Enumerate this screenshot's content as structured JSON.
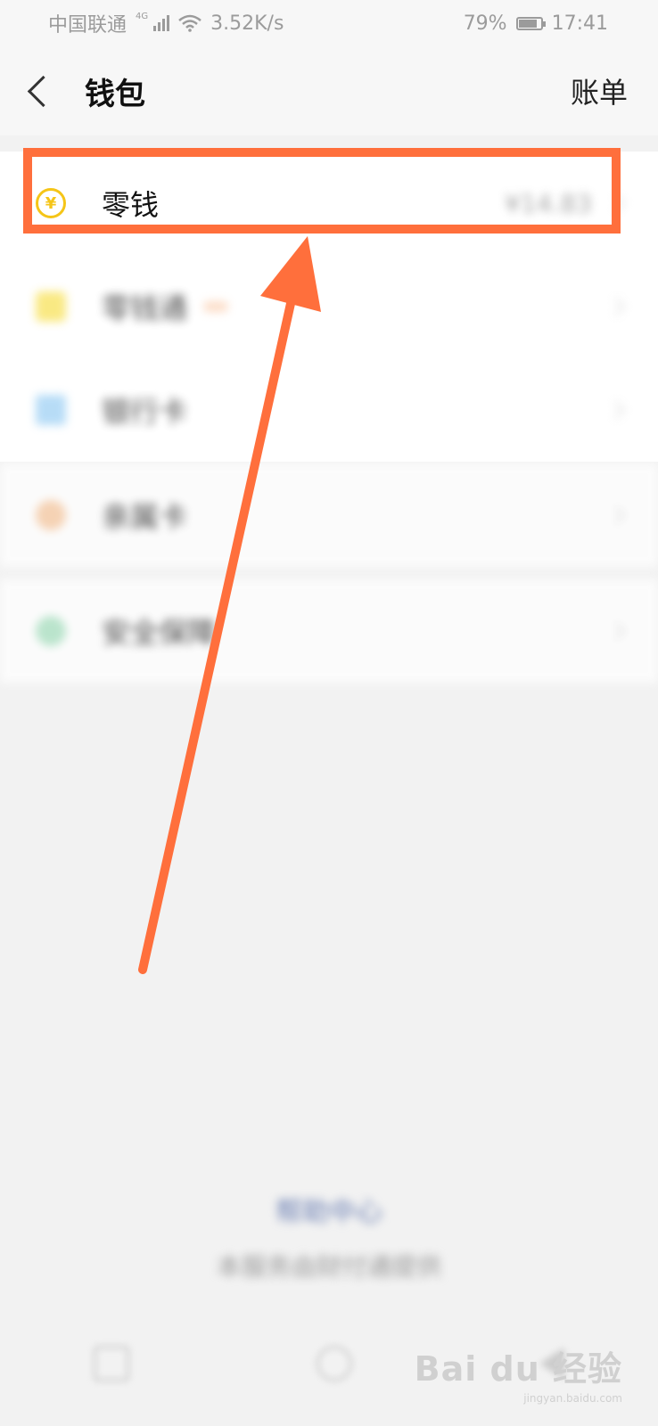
{
  "status_bar": {
    "carrier": "中国联通",
    "network_type": "4G",
    "speed": "3.52K/s",
    "battery": "79%",
    "battery_level": 0.79,
    "time": "17:41"
  },
  "navbar": {
    "title": "钱包",
    "action_label": "账单"
  },
  "wallet_items": [
    {
      "name": "零钱",
      "value": "¥14.83",
      "icon": "coin-icon",
      "icon_color": "#f5c518"
    },
    {
      "name": "零钱通",
      "badge": "",
      "icon": "shield-icon",
      "icon_color": "#f8e25a"
    },
    {
      "name": "银行卡",
      "icon": "card-icon",
      "icon_color": "#9fd1f4"
    },
    {
      "name": "亲属卡",
      "icon": "heart-icon",
      "icon_color": "#f7c8a0"
    },
    {
      "name": "安全保障",
      "icon": "safety-icon",
      "icon_color": "#a8e0c0"
    }
  ],
  "footer": {
    "help_link": "帮助中心",
    "notice": "本服务由财付通提供"
  },
  "watermark": {
    "brand": "Bai du 经验",
    "url": "jingyan.baidu.com"
  },
  "colors": {
    "annotation": "#ff6f3c",
    "background": "#f2f2f2"
  }
}
